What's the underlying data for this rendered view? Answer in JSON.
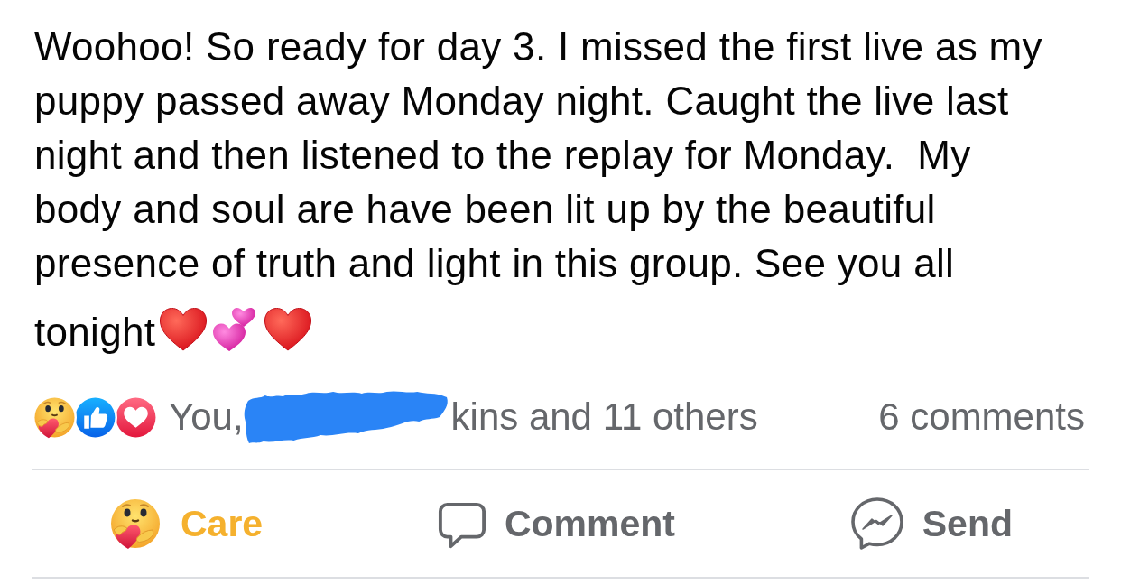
{
  "post": {
    "text_lines": [
      "Woohoo! So ready for day 3. I missed the first live as my",
      "puppy passed away Monday night. Caught the live last",
      "night and then listened to the replay for Monday.  My",
      "body and soul are have been lit up by the beautiful",
      "presence of truth and light in this group. See you all",
      "tonight"
    ],
    "trailing_emoji": [
      {
        "kind": "red-heart"
      },
      {
        "kind": "two-hearts"
      },
      {
        "kind": "red-heart"
      }
    ]
  },
  "reactions": {
    "icons": [
      {
        "kind": "care"
      },
      {
        "kind": "like"
      },
      {
        "kind": "love"
      }
    ],
    "names_start": "You,",
    "redacted": true,
    "names_end": "kins and 11 others",
    "comments": "6 comments"
  },
  "actions": [
    {
      "kind": "care",
      "label": "Care",
      "selected": true
    },
    {
      "kind": "comment",
      "label": "Comment",
      "selected": false
    },
    {
      "kind": "send",
      "label": "Send",
      "selected": false
    }
  ]
}
